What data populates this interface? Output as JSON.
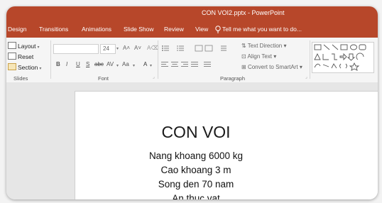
{
  "app": {
    "title": "CON VOI2.pptx - PowerPoint"
  },
  "tabs": [
    {
      "label": "Design"
    },
    {
      "label": "Transitions"
    },
    {
      "label": "Animations"
    },
    {
      "label": "Slide Show"
    },
    {
      "label": "Review"
    },
    {
      "label": "View"
    }
  ],
  "tellme": {
    "text": "Tell me what you want to do..."
  },
  "ribbon": {
    "slides": {
      "layout": "Layout",
      "reset": "Reset",
      "section": "Section",
      "group_label": "Slides"
    },
    "font": {
      "size": "24",
      "bold": "B",
      "italic": "I",
      "underline": "U",
      "strike": "S",
      "char_spacing": "AV",
      "change_case": "Aa",
      "group_label": "Font"
    },
    "paragraph": {
      "text_direction": "Text Direction",
      "align_text": "Align Text",
      "convert_smartart": "Convert to SmartArt",
      "group_label": "Paragraph"
    }
  },
  "slide": {
    "title": "CON VOI",
    "lines": [
      "Nang khoang 6000 kg",
      "Cao khoang 3 m",
      "Song den 70 nam",
      "An thuc vat"
    ]
  },
  "colors": {
    "accent": "#b7472a"
  }
}
